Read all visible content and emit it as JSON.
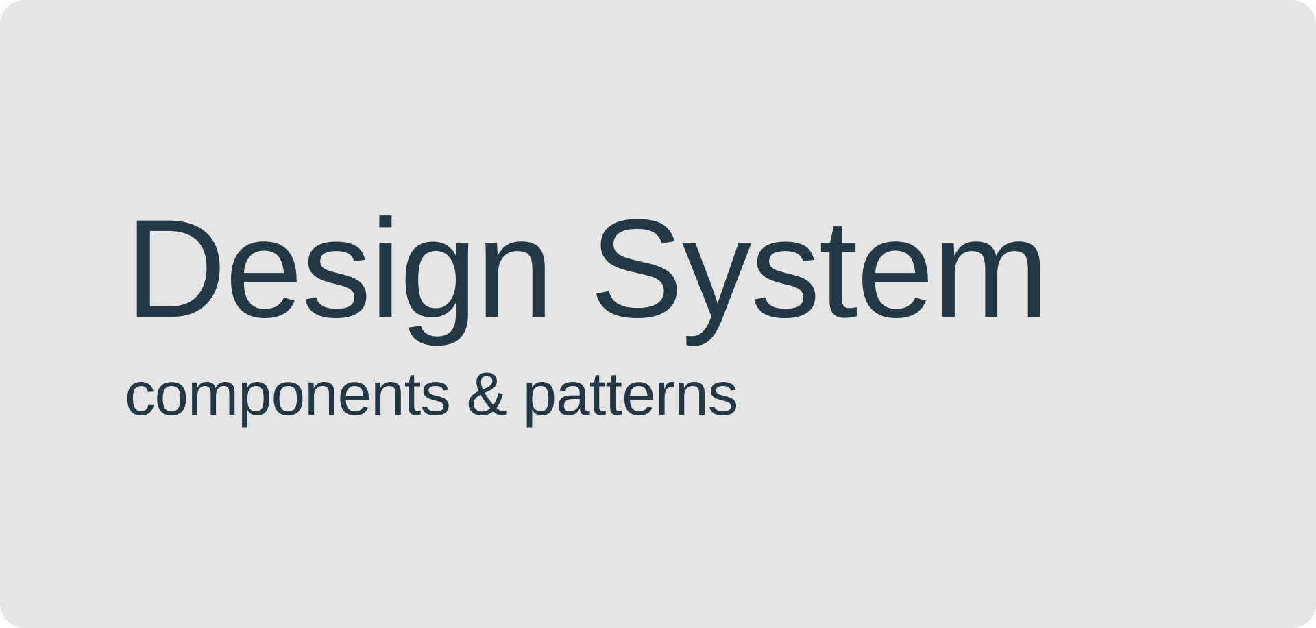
{
  "hero": {
    "title": "Design System",
    "subtitle": "components & patterns"
  },
  "colors": {
    "background": "#e5e5e5",
    "text": "#223845"
  }
}
